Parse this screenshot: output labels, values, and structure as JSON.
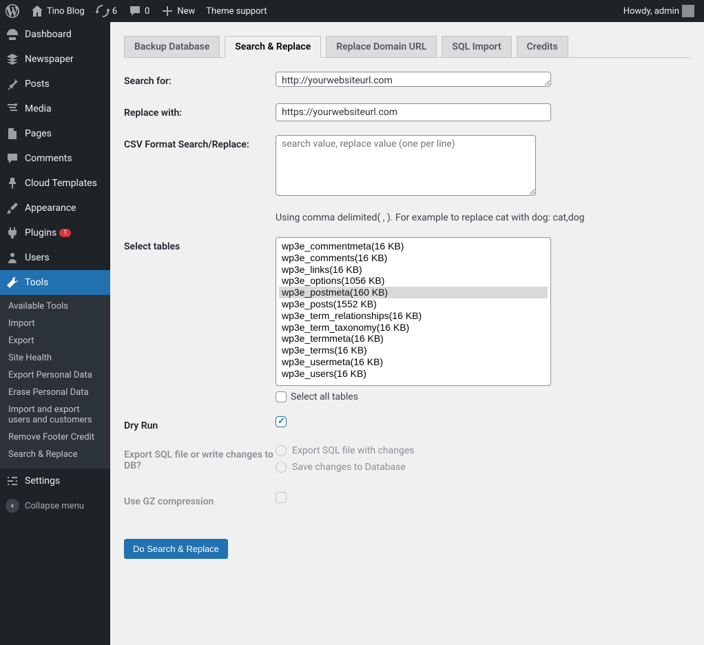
{
  "admin_bar": {
    "site_title": "Tino Blog",
    "updates": "6",
    "comments": "0",
    "new": "New",
    "theme_support": "Theme support",
    "greeting": "Howdy, admin"
  },
  "sidebar": {
    "items": [
      {
        "label": "Dashboard"
      },
      {
        "label": "Newspaper"
      },
      {
        "label": "Posts"
      },
      {
        "label": "Media"
      },
      {
        "label": "Pages"
      },
      {
        "label": "Comments"
      },
      {
        "label": "Cloud Templates"
      },
      {
        "label": "Appearance"
      },
      {
        "label": "Plugins",
        "badge": "1"
      },
      {
        "label": "Users"
      },
      {
        "label": "Tools",
        "active": true
      },
      {
        "label": "Settings"
      }
    ],
    "submenu": [
      "Available Tools",
      "Import",
      "Export",
      "Site Health",
      "Export Personal Data",
      "Erase Personal Data",
      "Import and export users and customers",
      "Remove Footer Credit",
      "Search & Replace"
    ],
    "collapse": "Collapse menu"
  },
  "tabs": [
    "Backup Database",
    "Search & Replace",
    "Replace Domain URL",
    "SQL Import",
    "Credits"
  ],
  "form": {
    "search_for_label": "Search for:",
    "search_for_value": "http://yourwebsiteurl.com",
    "replace_with_label": "Replace with:",
    "replace_with_value": "https://yourwebsiteurl.com",
    "csv_label": "CSV Format Search/Replace:",
    "csv_placeholder": "search value, replace value (one per line)",
    "csv_desc": "Using comma delimited( , ). For example to replace cat with dog: cat,dog",
    "select_tables_label": "Select tables",
    "tables": [
      "wp3e_commentmeta(16 KB)",
      "wp3e_comments(16 KB)",
      "wp3e_links(16 KB)",
      "wp3e_options(1056 KB)",
      "wp3e_postmeta(160 KB)",
      "wp3e_posts(1552 KB)",
      "wp3e_term_relationships(16 KB)",
      "wp3e_term_taxonomy(16 KB)",
      "wp3e_termmeta(16 KB)",
      "wp3e_terms(16 KB)",
      "wp3e_usermeta(16 KB)",
      "wp3e_users(16 KB)"
    ],
    "tables_selected_index": 4,
    "select_all_label": "Select all tables",
    "dry_run_label": "Dry Run",
    "export_label": "Export SQL file or write changes to DB?",
    "export_opt1": "Export SQL file with changes",
    "export_opt2": "Save changes to Database",
    "gz_label": "Use GZ compression",
    "submit": "Do Search & Replace"
  }
}
